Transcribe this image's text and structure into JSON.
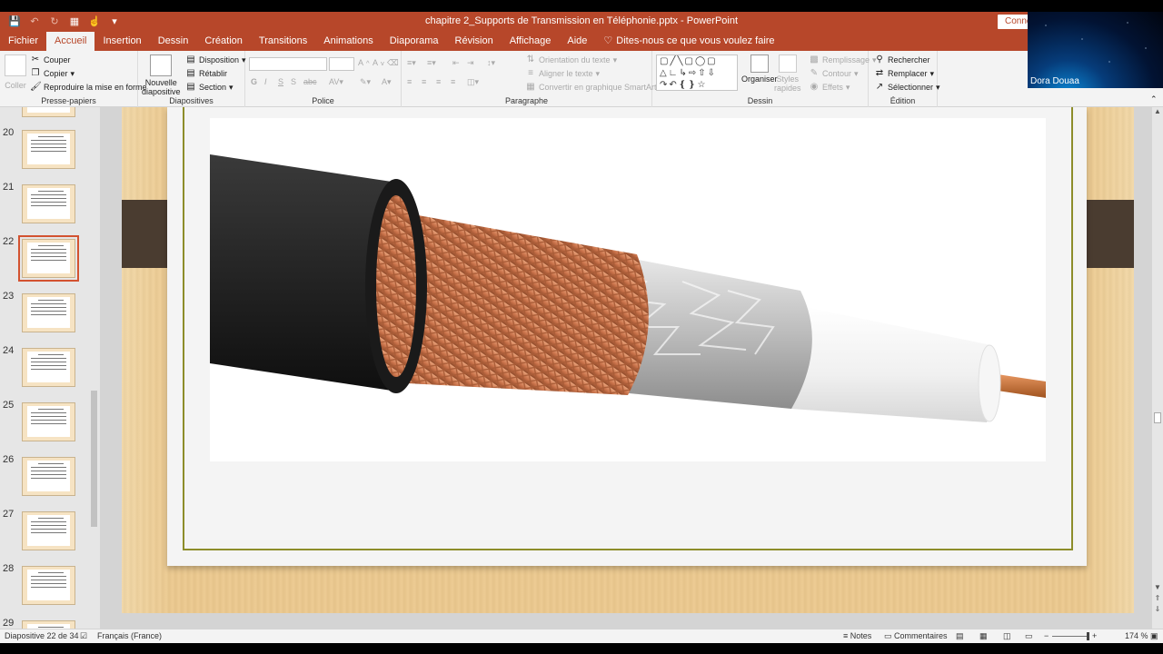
{
  "window": {
    "title": "chapitre 2_Supports de Transmission en Téléphonie.pptx  -  PowerPoint",
    "connect_label": "Connex",
    "accent": "#b7472a"
  },
  "ribbon_tabs": [
    {
      "label": "Fichier"
    },
    {
      "label": "Accueil",
      "active": true
    },
    {
      "label": "Insertion"
    },
    {
      "label": "Dessin"
    },
    {
      "label": "Création"
    },
    {
      "label": "Transitions"
    },
    {
      "label": "Animations"
    },
    {
      "label": "Diaporama"
    },
    {
      "label": "Révision"
    },
    {
      "label": "Affichage"
    },
    {
      "label": "Aide"
    },
    {
      "label": "Dites-nous ce que vous voulez faire",
      "icon": "lightbulb-icon"
    }
  ],
  "ribbon": {
    "clipboard": {
      "paste": "Coller",
      "cut": "Couper",
      "copy": "Copier",
      "format_painter": "Reproduire la mise en forme",
      "group": "Presse-papiers"
    },
    "slides": {
      "new_slide_line1": "Nouvelle",
      "new_slide_line2": "diapositive",
      "layout": "Disposition",
      "reset": "Rétablir",
      "section": "Section",
      "group": "Diapositives"
    },
    "font": {
      "bold": "G",
      "italic": "I",
      "underline": "S",
      "strike": "S",
      "spacing": "abc",
      "group": "Police"
    },
    "paragraph": {
      "text_direction": "Orientation du texte",
      "align_text": "Aligner le texte",
      "smartart": "Convertir en graphique SmartArt",
      "group": "Paragraphe"
    },
    "drawing": {
      "arrange": "Organiser",
      "quick_styles_line1": "Styles",
      "quick_styles_line2": "rapides",
      "fill": "Remplissage",
      "outline": "Contour",
      "effects": "Effets",
      "group": "Dessin"
    },
    "editing": {
      "find": "Rechercher",
      "replace": "Remplacer",
      "select": "Sélectionner",
      "group": "Édition"
    }
  },
  "webcam": {
    "name": "Dora Douaa"
  },
  "thumbnails": [
    {
      "number": "20"
    },
    {
      "number": "21"
    },
    {
      "number": "22",
      "selected": true
    },
    {
      "number": "23"
    },
    {
      "number": "24"
    },
    {
      "number": "25"
    },
    {
      "number": "26"
    },
    {
      "number": "27"
    },
    {
      "number": "28"
    },
    {
      "number": "29"
    }
  ],
  "slide": {
    "image_subject": "coaxial-cable-cutaway"
  },
  "statusbar": {
    "slide_info": "Diapositive 22 de 34",
    "language": "Français (France)",
    "notes": "Notes",
    "comments": "Commentaires",
    "zoom": "174 %"
  }
}
